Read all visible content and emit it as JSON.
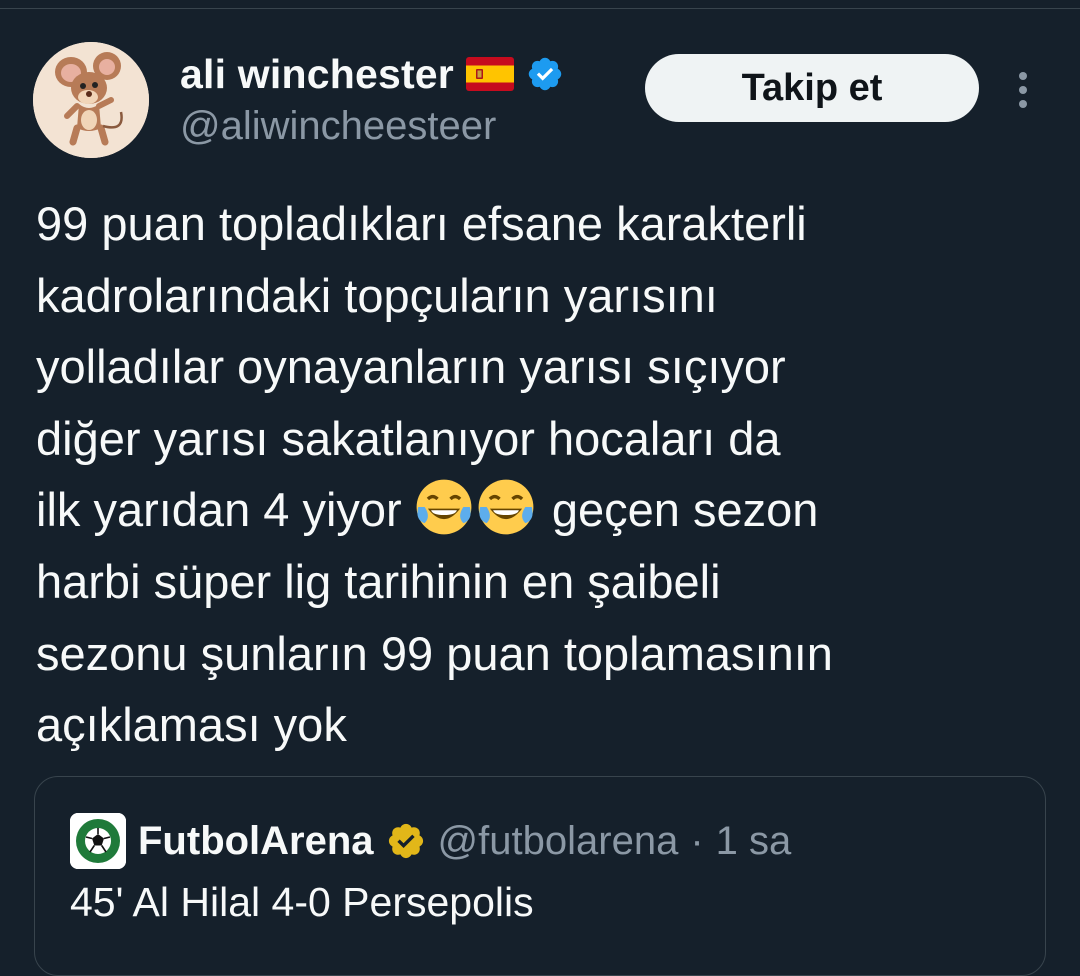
{
  "tweet": {
    "author": {
      "display_name": "ali winchester",
      "handle": "@aliwincheesteer",
      "flag_icon": "spain-flag-icon",
      "verified_icon": "verified-badge-icon",
      "verified_color": "#1d9bf0"
    },
    "follow_label": "Takip et",
    "more_icon": "more-vertical-icon",
    "text_lines": [
      "99 puan topladıkları efsane karakterli",
      "kadrolarındaki topçuların yarısını",
      "yolladılar oynayanların yarısı sıçıyor",
      "diğer yarısı sakatlanıyor hocaları da",
      {
        "before": "ilk yarıdan 4 yiyor ",
        "emoji": "😂😂",
        "after": " geçen sezon"
      },
      "harbi süper lig tarihinin en şaibeli",
      "sezonu şunların 99 puan toplamasının",
      "açıklaması yok"
    ],
    "emoji_icon": "tears-of-joy-emoji-icon"
  },
  "quoted": {
    "name": "FutbolArena",
    "handle": "@futbolarena",
    "separator": "·",
    "time": "1 sa",
    "text": "45' Al Hilal 4-0 Persepolis",
    "logo_icon": "soccer-ball-logo-icon",
    "badge_icon": "gold-verified-badge-icon",
    "badge_color": "#e2b719"
  },
  "colors": {
    "background": "#15202b",
    "text": "#f7f9f9",
    "secondary_text": "#8b98a5",
    "border": "#38444d",
    "button_bg": "#eff3f4"
  }
}
